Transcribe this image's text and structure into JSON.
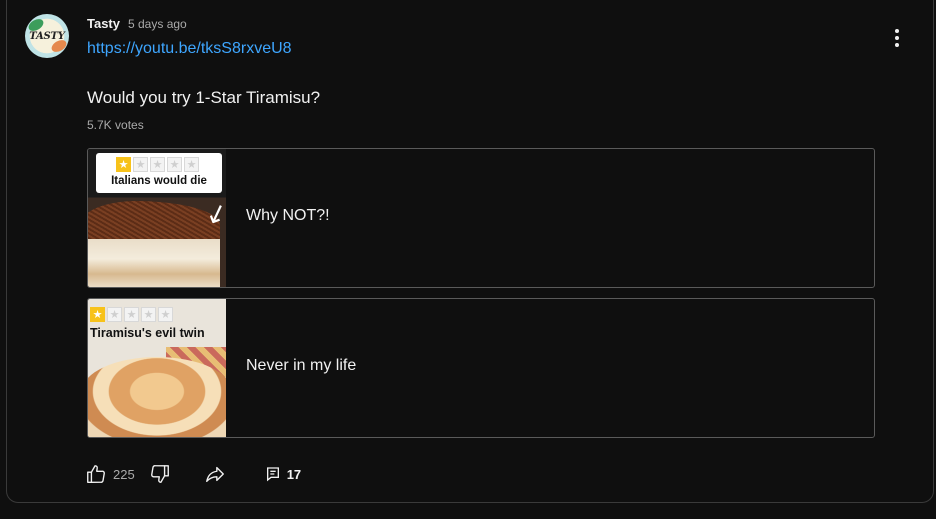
{
  "post": {
    "author": "Tasty",
    "time": "5 days ago",
    "link": "https://youtu.be/tksS8rxveU8",
    "question": "Would you try 1-Star Tiramisu?",
    "votes": "5.7K votes",
    "avatar_text": "TASTY"
  },
  "options": [
    {
      "text": "Why NOT?!",
      "thumb_caption": "Italians would die",
      "rating_stars": 1,
      "rating_max": 5
    },
    {
      "text": "Never in my life",
      "thumb_caption": "Tiramisu's evil twin",
      "rating_stars": 1,
      "rating_max": 5
    }
  ],
  "actions": {
    "like_count": "225",
    "comment_count": "17"
  },
  "icons": {
    "more": "more-vert-icon",
    "like": "thumb-up-icon",
    "dislike": "thumb-down-icon",
    "share": "share-icon",
    "comments": "comment-icon"
  },
  "colors": {
    "background": "#0f0f0f",
    "link": "#3ea6ff",
    "text": "#f1f1f1",
    "muted": "#aaaaaa",
    "star": "#f7c21a"
  }
}
